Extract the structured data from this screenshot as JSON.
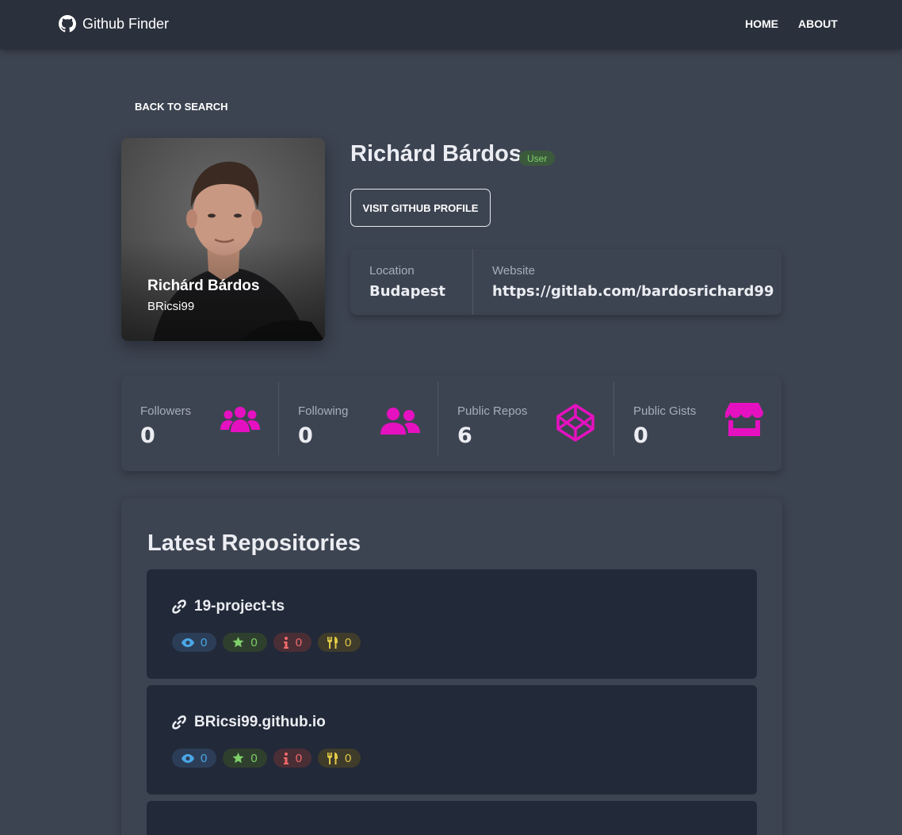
{
  "navbar": {
    "brand": "Github Finder",
    "links": [
      {
        "label": "HOME"
      },
      {
        "label": "ABOUT"
      }
    ]
  },
  "back_button": "BACK TO SEARCH",
  "profile": {
    "name": "Richárd Bárdos",
    "login": "BRicsi99",
    "type_badge": "User",
    "visit_button": "VISIT GITHUB PROFILE",
    "info": [
      {
        "label": "Location",
        "value": "Budapest"
      },
      {
        "label": "Website",
        "value": "https://gitlab.com/bardosrichard99"
      }
    ]
  },
  "stats": [
    {
      "label": "Followers",
      "value": "0",
      "icon": "users-icon"
    },
    {
      "label": "Following",
      "value": "0",
      "icon": "user-friends-icon"
    },
    {
      "label": "Public Repos",
      "value": "6",
      "icon": "codepen-icon"
    },
    {
      "label": "Public Gists",
      "value": "0",
      "icon": "store-icon"
    }
  ],
  "repos": {
    "title": "Latest Repositories",
    "items": [
      {
        "name": "19-project-ts",
        "watchers": "0",
        "stars": "0",
        "issues": "0",
        "forks": "0"
      },
      {
        "name": "BRicsi99.github.io",
        "watchers": "0",
        "stars": "0",
        "issues": "0",
        "forks": "0"
      }
    ]
  },
  "colors": {
    "accent": "#e511c0",
    "background": "#3d4451",
    "navbar": "#2a303c",
    "repo_card": "#222938"
  }
}
